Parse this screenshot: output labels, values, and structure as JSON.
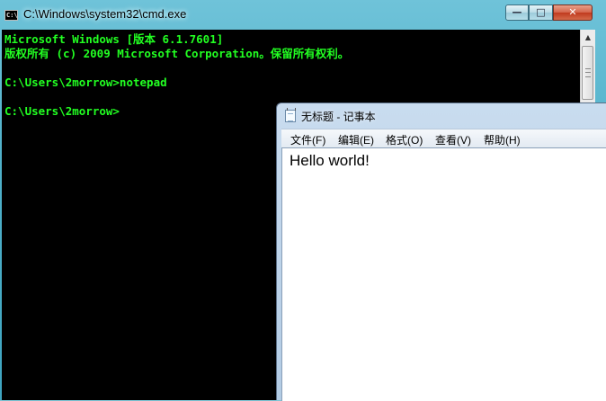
{
  "cmd": {
    "title": "C:\\Windows\\system32\\cmd.exe",
    "icon_label": "C:\\",
    "buttons": {
      "minimize": "—",
      "maximize": "□",
      "close": "✕"
    },
    "lines": [
      "Microsoft Windows [版本 6.1.7601]",
      "版权所有 (c) 2009 Microsoft Corporation。保留所有权利。",
      "",
      "C:\\Users\\2morrow>notepad",
      "",
      "C:\\Users\\2morrow>"
    ],
    "text_color": "#22ff22",
    "background": "#000000"
  },
  "notepad": {
    "title": "无标题 - 记事本",
    "menu": [
      "文件(F)",
      "编辑(E)",
      "格式(O)",
      "查看(V)",
      "帮助(H)"
    ],
    "content": "Hello world!"
  }
}
